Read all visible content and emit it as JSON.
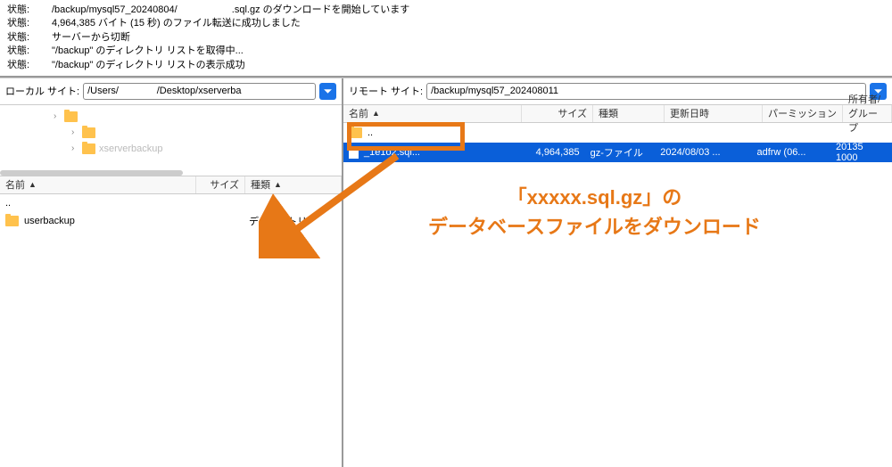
{
  "log": {
    "label": "状態:",
    "lines": [
      "/backup/mysql57_20240804/                    .sql.gz のダウンロードを開始しています",
      "4,964,385 バイト (15 秒) のファイル転送に成功しました",
      "サーバーから切断",
      "\"/backup\" のディレクトリ リストを取得中...",
      "\"/backup\" のディレクトリ リストの表示成功"
    ]
  },
  "local": {
    "label": "ローカル サイト:",
    "path": "/Users/              /Desktop/xserverba",
    "tree": [
      {
        "label": "",
        "indent": 1
      },
      {
        "label": "",
        "indent": 2
      },
      {
        "label": "xserverbackup",
        "indent": 2,
        "muted": true
      }
    ],
    "headers": {
      "name": "名前",
      "size": "サイズ",
      "type": "種類"
    },
    "rows": [
      {
        "name": "..",
        "type": ""
      },
      {
        "name": "userbackup",
        "type": "ディレクトリ"
      }
    ]
  },
  "remote": {
    "label": "リモート サイト:",
    "path": "/backup/mysql57_202408011",
    "headers": {
      "name": "名前",
      "size": "サイズ",
      "type": "種類",
      "date": "更新日時",
      "perm": "パーミッション",
      "owner": "所有者/グループ"
    },
    "parent": "..",
    "rows": [
      {
        "name": "              _1e1o2.sql...",
        "size": "4,964,385",
        "type": "gz-ファイル",
        "date": "2024/08/03 ...",
        "perm": "adfrw (06...",
        "owner": "20135 1000"
      }
    ]
  },
  "annotation": {
    "line1": "「xxxxx.sql.gz」の",
    "line2": "データベースファイルをダウンロード"
  }
}
